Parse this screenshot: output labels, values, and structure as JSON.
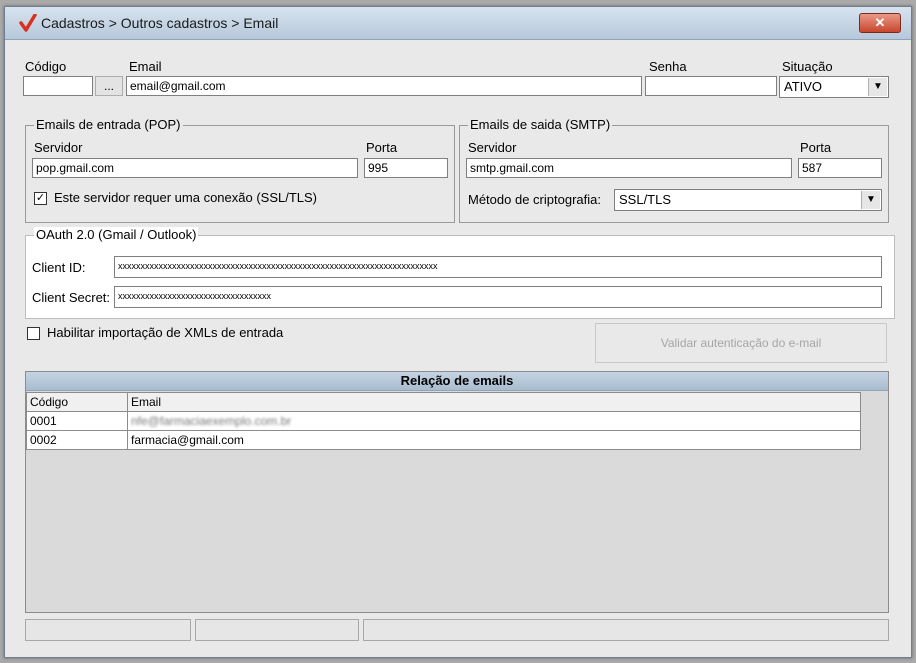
{
  "window": {
    "title": "Cadastros > Outros cadastros > Email",
    "close_label": "✕"
  },
  "top": {
    "codigo_label": "Código",
    "codigo_value": "",
    "lookup_button": "...",
    "email_label": "Email",
    "email_value": "email@gmail.com",
    "senha_label": "Senha",
    "senha_value": "",
    "situacao_label": "Situação",
    "situacao_value": "ATIVO"
  },
  "pop": {
    "legend": "Emails de entrada (POP)",
    "servidor_label": "Servidor",
    "servidor_value": "pop.gmail.com",
    "porta_label": "Porta",
    "porta_value": "995",
    "ssl_checked": true,
    "ssl_label": "Este servidor requer uma conexão (SSL/TLS)"
  },
  "smtp": {
    "legend": "Emails de saida (SMTP)",
    "servidor_label": "Servidor",
    "servidor_value": "smtp.gmail.com",
    "porta_label": "Porta",
    "porta_value": "587",
    "metodo_label": "Método de criptografia:",
    "metodo_value": "SSL/TLS"
  },
  "oauth": {
    "legend": "OAuth 2.0 (Gmail / Outlook)",
    "client_id_label": "Client ID:",
    "client_id_value": "xxxxxxxxxxxxxxxxxxxxxxxxxxxxxxxxxxxxxxxxxxxxxxxxxxxxxxxxxxxxxxxxxxxxxxx",
    "client_secret_label": "Client Secret:",
    "client_secret_value": "xxxxxxxxxxxxxxxxxxxxxxxxxxxxxxxxxx"
  },
  "import": {
    "checked": false,
    "label": "Habilitar importação de XMLs de entrada"
  },
  "validate_button": "Validar autenticação do e-mail",
  "list": {
    "caption": "Relação de emails",
    "columns": [
      "Código",
      "Email"
    ],
    "rows": [
      {
        "codigo": "0001",
        "email": "nfe@farmaciaexemplo.com.br"
      },
      {
        "codigo": "0002",
        "email": "farmacia@gmail.com"
      }
    ]
  }
}
